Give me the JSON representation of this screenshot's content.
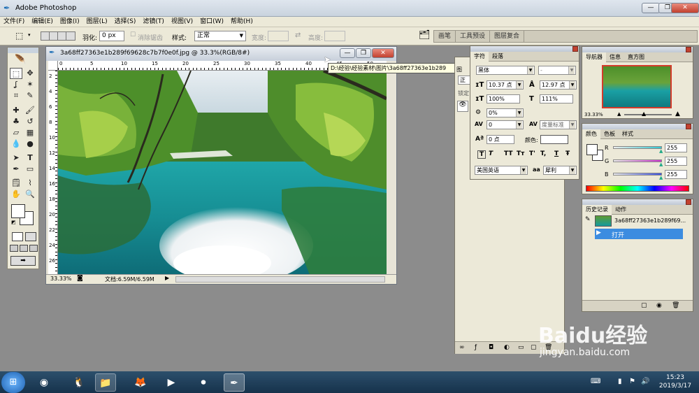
{
  "app": {
    "title": "Adobe Photoshop"
  },
  "window_buttons": {
    "minimize": "—",
    "restore": "❐",
    "close": "✕"
  },
  "menu": [
    "文件(F)",
    "编辑(E)",
    "图像(I)",
    "图层(L)",
    "选择(S)",
    "滤镜(T)",
    "视图(V)",
    "窗口(W)",
    "帮助(H)"
  ],
  "options": {
    "feather_label": "羽化:",
    "feather_value": "0 px",
    "antialias_label": "消除锯齿",
    "style_label": "样式:",
    "style_value": "正常",
    "width_label": "宽度:",
    "height_label": "高度:"
  },
  "palette_well": [
    "画笔",
    "工具预设",
    "图层复合"
  ],
  "document": {
    "title": "3a68ff27363e1b289f69628c7b7f0e0f.jpg @ 33.3%(RGB/8#)",
    "zoom": "33.33%",
    "doc_info": "文档:6.59M/6.59M",
    "ruler_h": [
      "0",
      "5",
      "10",
      "15",
      "20",
      "25",
      "30",
      "35",
      "40",
      "45",
      "50"
    ],
    "ruler_v": [
      "2",
      "4",
      "6",
      "8",
      "10",
      "12",
      "14",
      "16",
      "18",
      "20",
      "22",
      "24",
      "26"
    ]
  },
  "tooltip": "D:\\经验\\经验素材\\图片\\3a68ff27363e1b289",
  "character_panel": {
    "tabs": [
      "字符",
      "段落"
    ],
    "font_family": "黑体",
    "font_style": "-",
    "font_size": "10.37 点",
    "leading": "12.97 点",
    "vertical_scale": "100%",
    "horizontal_scale": "111%",
    "tracking_pct": "0%",
    "kerning": "0",
    "kerning_method": "度量标准",
    "baseline": "0 点",
    "color_label": "颜色:",
    "style_buttons": [
      "T",
      "T",
      "TT",
      "Tт",
      "T'",
      "T,",
      "T",
      "Ŧ"
    ],
    "language": "美国英语",
    "aa_label": "aa",
    "antialias": "犀利"
  },
  "layers_panel": {
    "tab": "图",
    "mode": "正",
    "lock": "锁定"
  },
  "navigator_panel": {
    "tabs": [
      "导航器",
      "信息",
      "直方图"
    ],
    "zoom": "33.33%"
  },
  "color_panel": {
    "tabs": [
      "颜色",
      "色板",
      "样式"
    ],
    "channels": [
      {
        "label": "R",
        "value": "255"
      },
      {
        "label": "G",
        "value": "255"
      },
      {
        "label": "B",
        "value": "255"
      }
    ],
    "colors": {
      "r": "#33c8d0",
      "g": "#d033d0",
      "b": "#3a50e0"
    }
  },
  "history_panel": {
    "tabs": [
      "历史记录",
      "动作"
    ],
    "snapshot": "3a68ff27363e1b289f69...",
    "step": "打开"
  },
  "watermark": {
    "brand": "Baidu经验",
    "url": "jingyan.baidu.com"
  },
  "taskbar": {
    "time": "15:23",
    "date": "2019/3/17"
  }
}
